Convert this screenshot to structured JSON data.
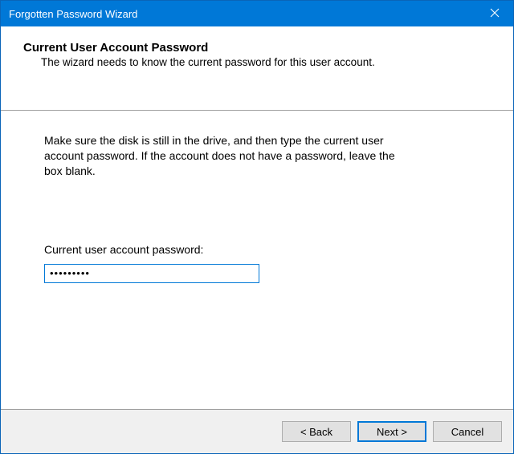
{
  "titlebar": {
    "title": "Forgotten Password Wizard"
  },
  "header": {
    "title": "Current User Account Password",
    "subtitle": "The wizard needs to know the current password for this user account."
  },
  "content": {
    "instruction": "Make sure the disk is still in the drive, and then type the current user account password. If the account does not have a password, leave the box blank.",
    "field_label": "Current user account password:",
    "password_value": "•••••••••"
  },
  "footer": {
    "back_label": "< Back",
    "next_label": "Next >",
    "cancel_label": "Cancel"
  }
}
